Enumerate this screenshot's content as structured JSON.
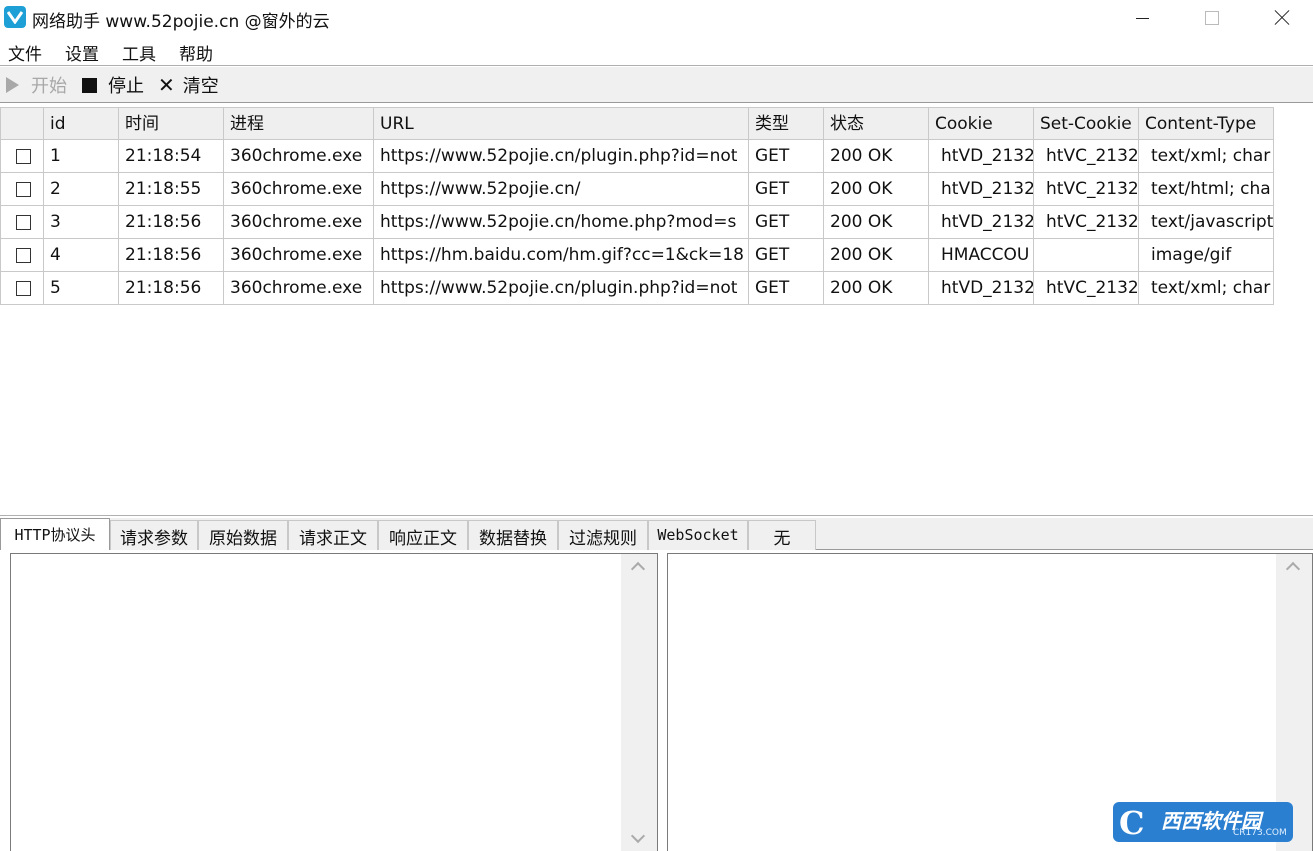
{
  "window": {
    "title": "网络助手  www.52pojie.cn @窗外的云"
  },
  "menu": [
    "文件",
    "设置",
    "工具",
    "帮助"
  ],
  "toolbar": {
    "start_label": "开始",
    "stop_label": "停止",
    "clear_label": "清空",
    "clear_icon": "✕"
  },
  "table": {
    "columns": [
      "id",
      "时间",
      "进程",
      "URL",
      "类型",
      "状态",
      "Cookie",
      "Set-Cookie",
      "Content-Type"
    ],
    "rows": [
      [
        "1",
        "21:18:54",
        "360chrome.exe",
        "https://www.52pojie.cn/plugin.php?id=not",
        "GET",
        "200 OK",
        "htVD_2132",
        "htVC_2132",
        "text/xml; char"
      ],
      [
        "2",
        "21:18:55",
        "360chrome.exe",
        "https://www.52pojie.cn/",
        "GET",
        "200 OK",
        "htVD_2132",
        "htVC_2132",
        "text/html; cha"
      ],
      [
        "3",
        "21:18:56",
        "360chrome.exe",
        "https://www.52pojie.cn/home.php?mod=s",
        "GET",
        "200 OK",
        "htVD_2132",
        "htVC_2132",
        "text/javascript"
      ],
      [
        "4",
        "21:18:56",
        "360chrome.exe",
        "https://hm.baidu.com/hm.gif?cc=1&ck=18",
        "GET",
        "200 OK",
        "HMACCOU",
        "",
        "image/gif"
      ],
      [
        "5",
        "21:18:56",
        "360chrome.exe",
        "https://www.52pojie.cn/plugin.php?id=not",
        "GET",
        "200 OK",
        "htVD_2132",
        "htVC_2132",
        "text/xml; char"
      ]
    ]
  },
  "tabs": [
    "HTTP协议头",
    "请求参数",
    "原始数据",
    "请求正文",
    "响应正文",
    "数据替换",
    "过滤规则",
    "WebSocket",
    "无"
  ],
  "watermark": {
    "logo_letter": "C",
    "text": "西西软件园",
    "sub": "CR173.COM"
  },
  "colors": {
    "app_icon": "#1ea0d6",
    "toolbar_bg": "#f0f0f0",
    "disabled_text": "#a8a8a8"
  }
}
